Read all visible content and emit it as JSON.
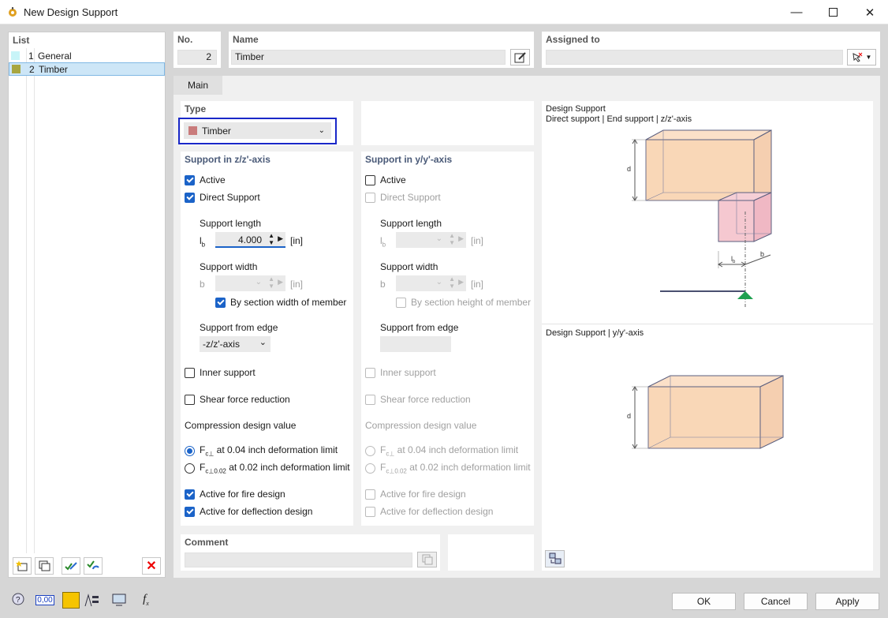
{
  "window": {
    "title": "New Design Support"
  },
  "list": {
    "header": "List",
    "items": [
      {
        "no": "1",
        "name": "General",
        "color": "#c8f4f8"
      },
      {
        "no": "2",
        "name": "Timber",
        "color": "#a8a640"
      }
    ]
  },
  "no": {
    "label": "No.",
    "value": "2"
  },
  "name": {
    "label": "Name",
    "value": "Timber"
  },
  "assigned": {
    "label": "Assigned to",
    "value": ""
  },
  "tabs": [
    {
      "label": "Main"
    }
  ],
  "type": {
    "label": "Type",
    "value": "Timber",
    "color": "#c97b7b"
  },
  "zaxis": {
    "title": "Support in z/z'-axis",
    "active": "Active",
    "direct": "Direct Support",
    "support_length": "Support length",
    "lb_symbol": "l",
    "lb_sub": "b",
    "length_value": "4.000",
    "unit": "[in]",
    "support_width": "Support width",
    "b_symbol": "b",
    "by_section": "By section width of member",
    "from_edge": "Support from edge",
    "edge_value": "-z/z'-axis",
    "inner": "Inner support",
    "shear": "Shear force reduction",
    "compression": "Compression design value",
    "fc_sym": "F",
    "fc_sub": "c⊥",
    "opt1": "at 0.04 inch deformation limit",
    "fc2_sub": "c⊥0.02",
    "opt2": "at 0.02 inch deformation limit",
    "fire": "Active for fire design",
    "deflection": "Active for deflection design"
  },
  "yaxis": {
    "title": "Support in y/y'-axis",
    "active": "Active",
    "direct": "Direct Support",
    "support_length": "Support length",
    "lb_symbol": "l",
    "lb_sub": "b",
    "unit": "[in]",
    "support_width": "Support width",
    "b_symbol": "b",
    "by_section": "By section height of member",
    "from_edge": "Support from edge",
    "inner": "Inner support",
    "shear": "Shear force reduction",
    "compression": "Compression design value",
    "fc_sym": "F",
    "fc_sub": "c⊥",
    "opt1": "at 0.04 inch deformation limit",
    "fc2_sub": "c⊥0.02",
    "opt2": "at 0.02 inch deformation limit",
    "fire": "Active for fire design",
    "deflection": "Active for deflection design"
  },
  "diagram1": {
    "title": "Design Support",
    "subtitle": "Direct support | End support | z/z'-axis",
    "d": "d",
    "lb": "l",
    "lb_sub": "b",
    "b": "b"
  },
  "diagram2": {
    "title": "Design Support | y/y'-axis",
    "d": "d"
  },
  "comment": {
    "label": "Comment",
    "value": ""
  },
  "bottom": {
    "ok": "OK",
    "cancel": "Cancel",
    "apply": "Apply",
    "units_text": "0,00"
  }
}
